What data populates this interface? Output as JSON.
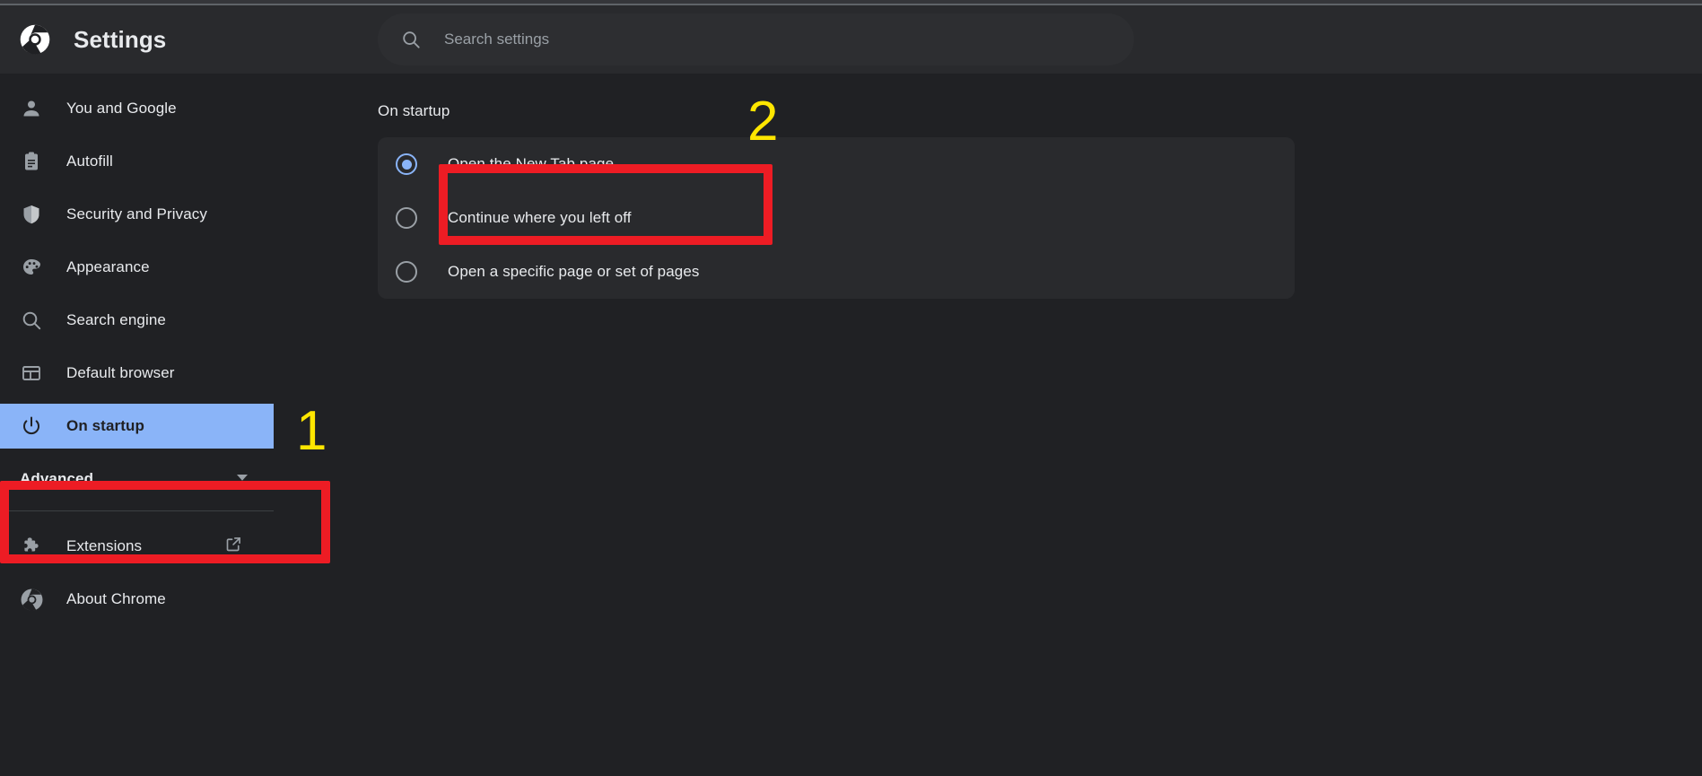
{
  "header": {
    "title": "Settings",
    "logo_icon": "chrome-logo-icon",
    "search": {
      "icon": "search-icon",
      "placeholder": "Search settings",
      "value": ""
    }
  },
  "sidebar": {
    "items": [
      {
        "label": "You and Google",
        "icon": "person-icon",
        "selected": false
      },
      {
        "label": "Autofill",
        "icon": "clipboard-icon",
        "selected": false
      },
      {
        "label": "Security and Privacy",
        "icon": "shield-icon",
        "selected": false
      },
      {
        "label": "Appearance",
        "icon": "palette-icon",
        "selected": false
      },
      {
        "label": "Search engine",
        "icon": "search-icon",
        "selected": false
      },
      {
        "label": "Default browser",
        "icon": "browser-window-icon",
        "selected": false
      },
      {
        "label": "On startup",
        "icon": "power-icon",
        "selected": true
      }
    ],
    "advanced": {
      "label": "Advanced",
      "icon": "chevron-down-icon"
    },
    "footer_items": [
      {
        "label": "Extensions",
        "icon": "puzzle-piece-icon",
        "trailing_icon": "external-link-icon"
      },
      {
        "label": "About Chrome",
        "icon": "chrome-logo-icon",
        "trailing_icon": ""
      }
    ]
  },
  "main": {
    "section_title": "On startup",
    "options": [
      {
        "label": "Open the New Tab page",
        "selected": true
      },
      {
        "label": "Continue where you left off",
        "selected": false
      },
      {
        "label": "Open a specific page or set of pages",
        "selected": false
      }
    ]
  },
  "annotations": {
    "step_one": "1",
    "step_two": "2",
    "box_color": "#ed1c24",
    "number_color": "#ffe600",
    "highlight_color": "#8ab4f8"
  }
}
